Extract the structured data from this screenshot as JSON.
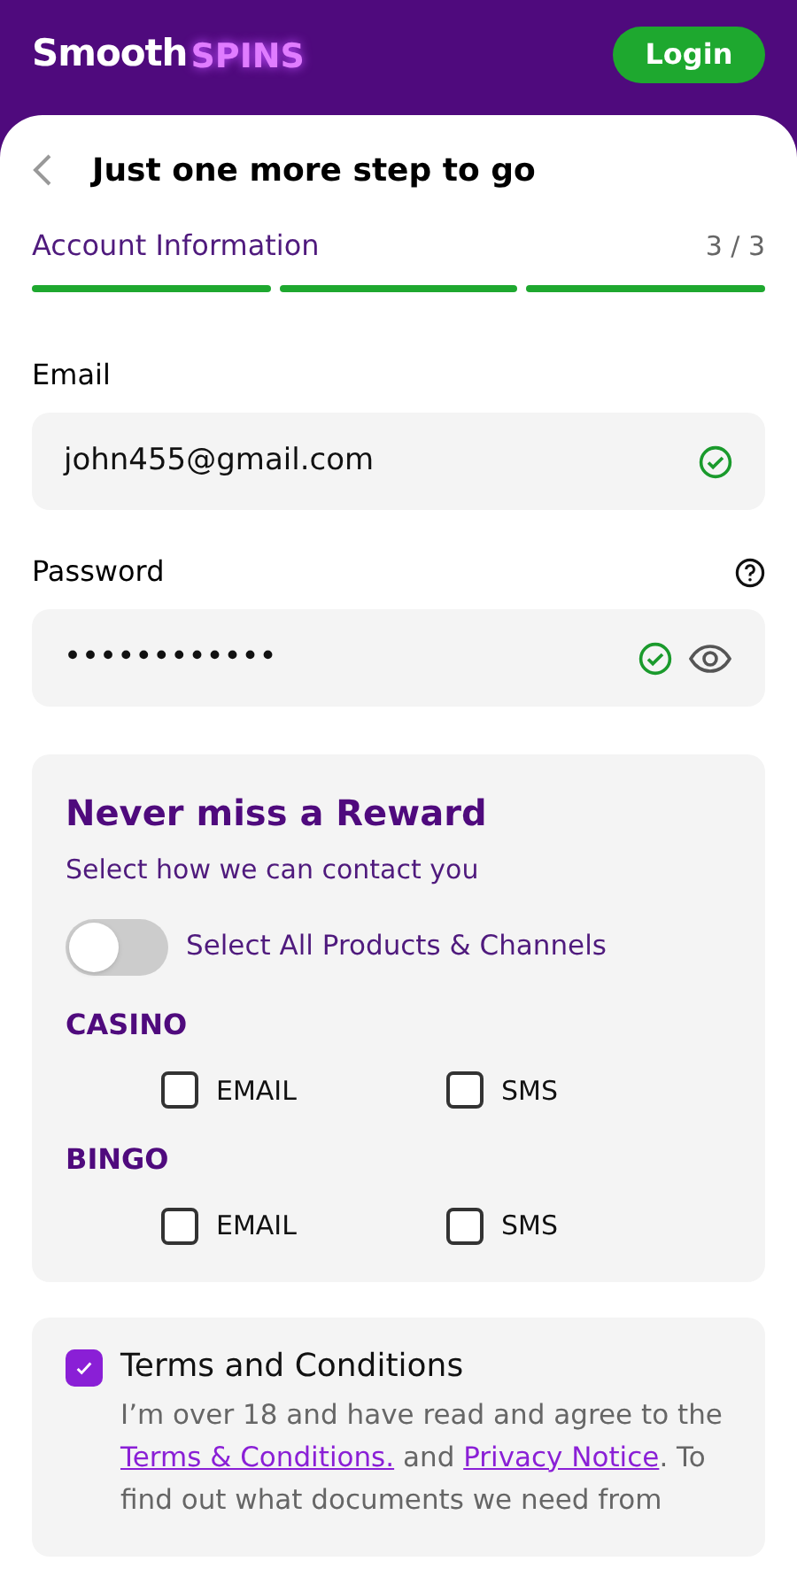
{
  "header": {
    "logo": {
      "word": "Smooth",
      "accent": "SPINS"
    },
    "login_button": "Login"
  },
  "page": {
    "title": "Just one more step to go"
  },
  "stepper": {
    "label": "Account Information",
    "count": "3 / 3",
    "steps": [
      {
        "complete": true
      },
      {
        "complete": true
      },
      {
        "complete": true
      }
    ]
  },
  "fields": [
    {
      "label": "Email",
      "value": "john455@gmail.com",
      "valid": true,
      "kind": "email"
    },
    {
      "label": "Password",
      "value": "••••••••••••",
      "valid": true,
      "kind": "password"
    }
  ],
  "rewards": {
    "title": "Never miss a Reward",
    "subtitle": "Select how we can contact you",
    "select_all": {
      "label": "Select All Products & Channels",
      "on": false
    },
    "groups": [
      {
        "name": "CASINO",
        "options": [
          {
            "label": "EMAIL",
            "checked": false
          },
          {
            "label": "SMS",
            "checked": false
          }
        ]
      },
      {
        "name": "BINGO",
        "options": [
          {
            "label": "EMAIL",
            "checked": false
          },
          {
            "label": "SMS",
            "checked": false
          }
        ]
      }
    ]
  },
  "terms": {
    "title": "Terms and Conditions",
    "checked": true,
    "text_before": "I’m over 18 and have read and agree to the",
    "link_1": "Terms & Conditions.",
    "text_middle": "and",
    "link_2": "Privacy Notice",
    "text_after": ". To find out what documents we need from"
  }
}
